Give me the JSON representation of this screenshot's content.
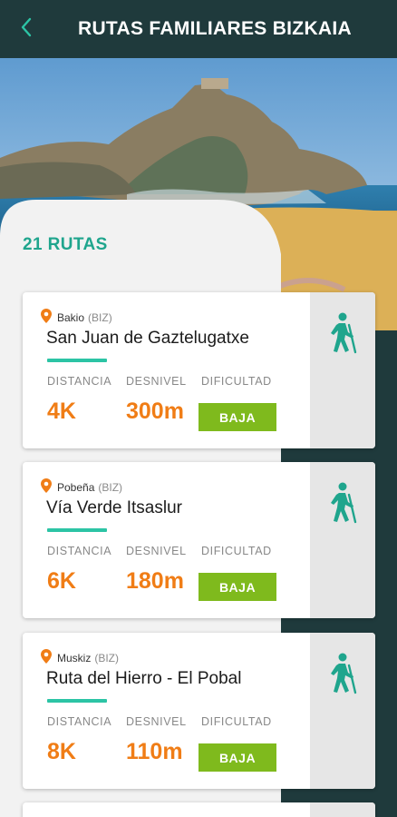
{
  "header": {
    "title": "RUTAS FAMILIARES BIZKAIA"
  },
  "colors": {
    "accent": "#1fa58d",
    "value": "#f07d16",
    "badge": "#7fba1d",
    "header_bg": "#1f3a3c"
  },
  "routes_count": "21 RUTAS",
  "stat_labels": {
    "distance": "DISTANCIA",
    "elevation": "DESNIVEL",
    "difficulty": "DIFICULTAD"
  },
  "routes": [
    {
      "town": "Bakio",
      "region": "(BIZ)",
      "name": "San Juan de Gaztelugatxe",
      "distance": "4K",
      "elevation": "300m",
      "difficulty": "BAJA",
      "icon": "hiker-icon"
    },
    {
      "town": "Pobeña",
      "region": "(BIZ)",
      "name": "Vía Verde Itsaslur",
      "distance": "6K",
      "elevation": "180m",
      "difficulty": "BAJA",
      "icon": "hiker-icon"
    },
    {
      "town": "Muskiz",
      "region": "(BIZ)",
      "name": "Ruta del Hierro - El Pobal",
      "distance": "8K",
      "elevation": "110m",
      "difficulty": "BAJA",
      "icon": "hiker-icon"
    }
  ]
}
